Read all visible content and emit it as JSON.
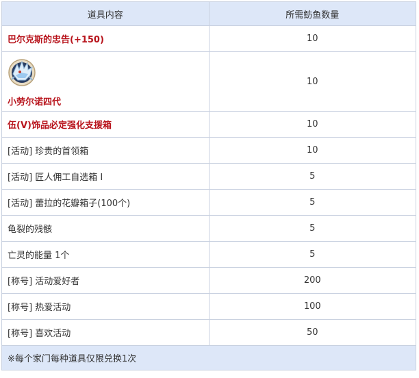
{
  "table": {
    "headers": [
      "道具内容",
      "所需鲂鱼数量"
    ],
    "rows": [
      {
        "item": "巴尔克斯的忠告(+150)",
        "count": "10",
        "highlight": true
      },
      {
        "item": "小劳尔诺四代",
        "count": "10",
        "highlight": true,
        "icon": "dragon-head-icon"
      },
      {
        "item": "伍(V)饰品必定强化支援箱",
        "count": "10",
        "highlight": true
      },
      {
        "item": "[活动] 珍贵的首领箱",
        "count": "10",
        "highlight": false
      },
      {
        "item": "[活动] 匠人佣工自选箱 I",
        "count": "5",
        "highlight": false
      },
      {
        "item": "[活动] 蕾拉的花瓣箱子(100个)",
        "count": "5",
        "highlight": false
      },
      {
        "item": "龟裂的残骸",
        "count": "5",
        "highlight": false
      },
      {
        "item": "亡灵的能量 1个",
        "count": "5",
        "highlight": false
      },
      {
        "item": "[称号] 活动爱好者",
        "count": "200",
        "highlight": false
      },
      {
        "item": "[称号] 热爱活动",
        "count": "100",
        "highlight": false
      },
      {
        "item": "[称号] 喜欢活动",
        "count": "50",
        "highlight": false
      }
    ],
    "note": "※每个家门每种道具仅限兑换1次"
  },
  "colors": {
    "header_bg": "#dde7f8",
    "highlight_text": "#b8141c",
    "border": "#c9d1e0"
  }
}
